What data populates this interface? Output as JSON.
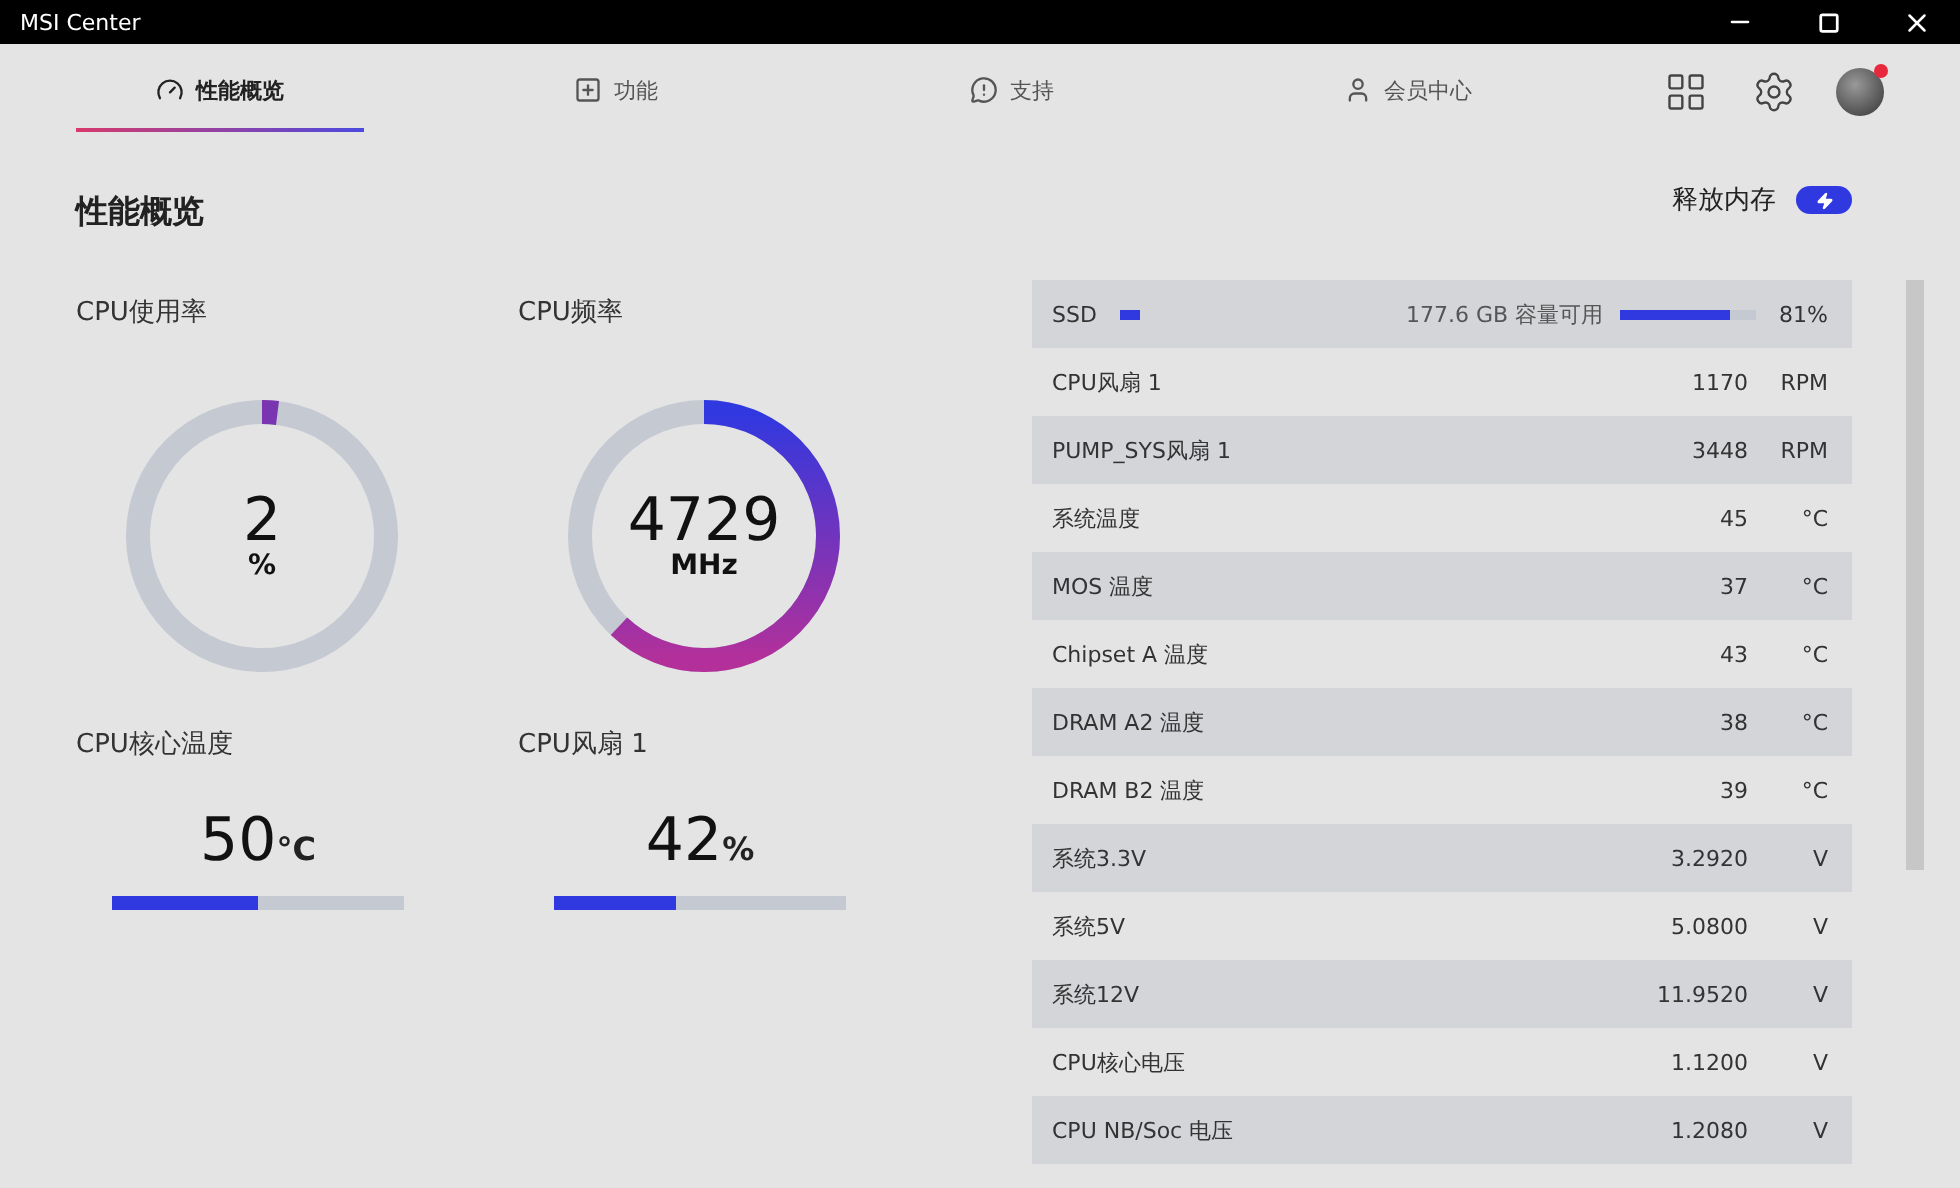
{
  "window": {
    "title": "MSI Center"
  },
  "tabs": [
    {
      "label": "性能概览",
      "selected": true
    },
    {
      "label": "功能",
      "selected": false
    },
    {
      "label": "支持",
      "selected": false
    },
    {
      "label": "会员中心",
      "selected": false
    }
  ],
  "page": {
    "title": "性能概览",
    "release_memory": "释放内存"
  },
  "gauges": [
    {
      "label": "CPU使用率",
      "kind": "ring",
      "value": "2",
      "unit": "%",
      "level": 0.02
    },
    {
      "label": "CPU频率",
      "kind": "ring",
      "value": "4729",
      "unit": "MHz",
      "level": 0.62
    },
    {
      "label": "CPU核心温度",
      "kind": "bar",
      "value": "50",
      "unit": "°C",
      "level": 0.5
    },
    {
      "label": "CPU风扇 1",
      "kind": "bar",
      "value": "42",
      "unit": "%",
      "level": 0.42
    }
  ],
  "sensors": [
    {
      "kind": "disk",
      "name": "SSD",
      "free": "177.6 GB 容量可用",
      "level": 0.81,
      "value": "81%"
    },
    {
      "kind": "reading",
      "name": "CPU风扇 1",
      "value": "1170",
      "unit": "RPM"
    },
    {
      "kind": "reading",
      "name": "PUMP_SYS风扇 1",
      "value": "3448",
      "unit": "RPM"
    },
    {
      "kind": "reading",
      "name": "系统温度",
      "value": "45",
      "unit": "°C"
    },
    {
      "kind": "reading",
      "name": "MOS 温度",
      "value": "37",
      "unit": "°C"
    },
    {
      "kind": "reading",
      "name": "Chipset A 温度",
      "value": "43",
      "unit": "°C"
    },
    {
      "kind": "reading",
      "name": "DRAM A2 温度",
      "value": "38",
      "unit": "°C"
    },
    {
      "kind": "reading",
      "name": "DRAM B2 温度",
      "value": "39",
      "unit": "°C"
    },
    {
      "kind": "reading",
      "name": "系统3.3V",
      "value": "3.2920",
      "unit": "V"
    },
    {
      "kind": "reading",
      "name": "系统5V",
      "value": "5.0800",
      "unit": "V"
    },
    {
      "kind": "reading",
      "name": "系统12V",
      "value": "11.9520",
      "unit": "V"
    },
    {
      "kind": "reading",
      "name": "CPU核心电压",
      "value": "1.1200",
      "unit": "V"
    },
    {
      "kind": "reading",
      "name": "CPU NB/Soc 电压",
      "value": "1.2080",
      "unit": "V"
    }
  ]
}
